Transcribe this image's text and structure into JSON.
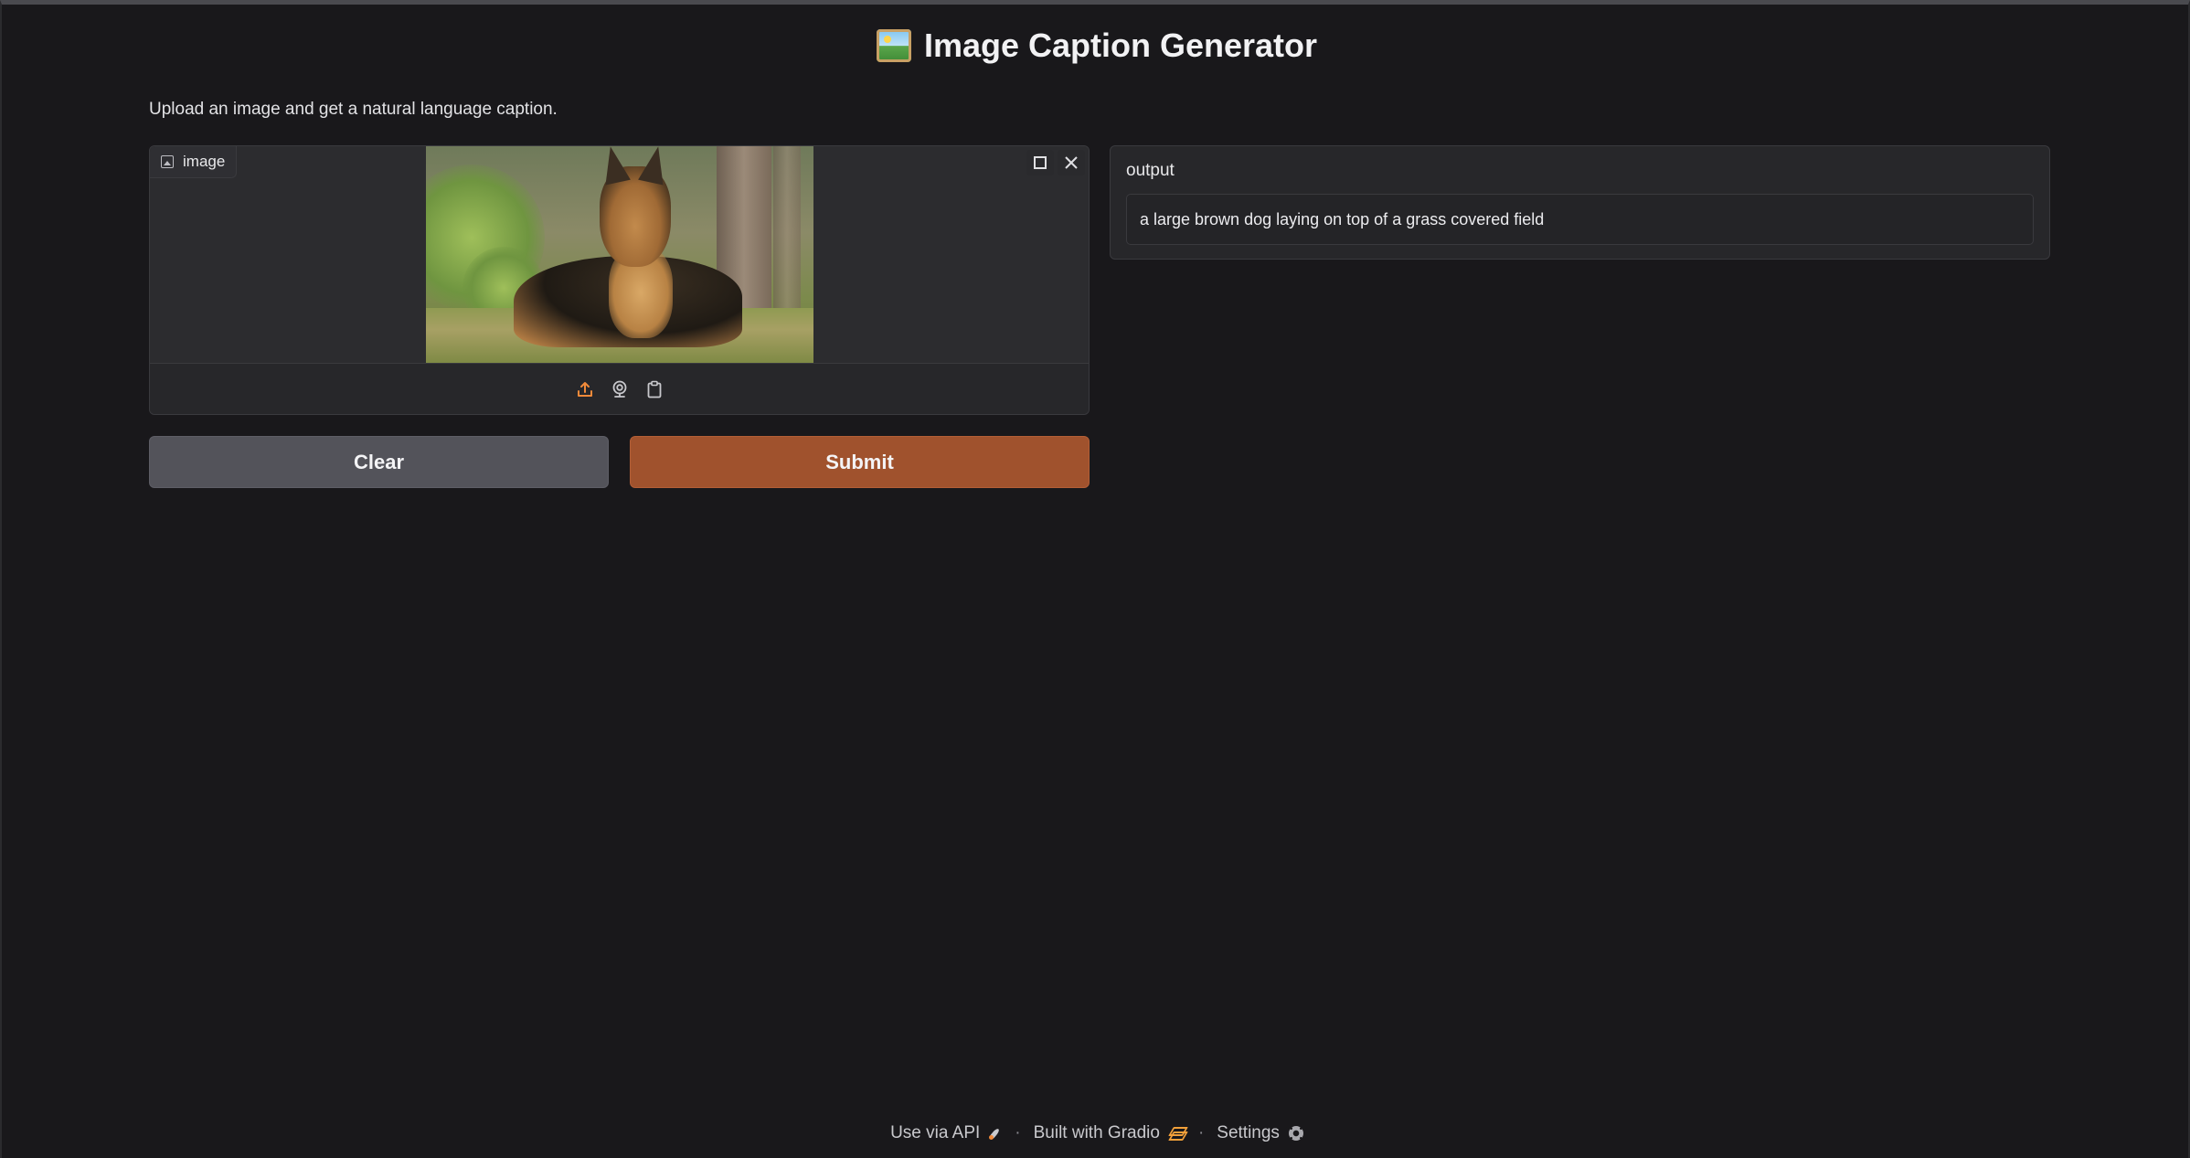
{
  "app": {
    "title": "Image Caption Generator",
    "title_icon": "framed-picture-emoji",
    "description": "Upload an image and get a natural language caption."
  },
  "input": {
    "label": "image",
    "label_icon": "image-icon",
    "toolbar_icons": [
      "fullscreen-icon",
      "close-icon"
    ],
    "source_icons": [
      "upload-icon",
      "webcam-icon",
      "clipboard-icon"
    ]
  },
  "buttons": {
    "clear": "Clear",
    "submit": "Submit"
  },
  "output": {
    "label": "output",
    "value": "a large brown dog laying on top of a grass covered field"
  },
  "footer": {
    "api": "Use via API",
    "built": "Built with Gradio",
    "settings": "Settings",
    "separator": "·"
  },
  "colors": {
    "background": "#19181b",
    "panel": "#27272a",
    "submit": "#a0522d",
    "clear": "#53535a",
    "accent": "#f08a3a"
  }
}
